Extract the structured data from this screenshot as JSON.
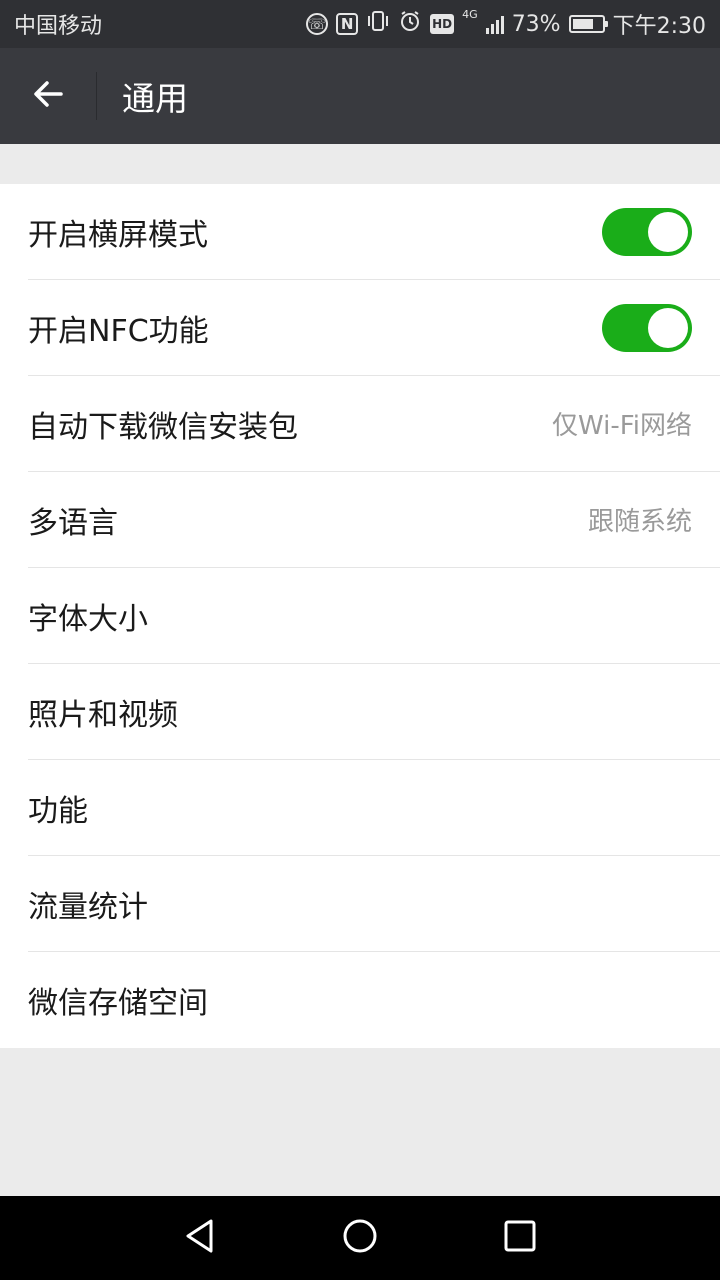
{
  "status_bar": {
    "carrier": "中国移动",
    "icons": [
      "hd-call-icon",
      "nfc-icon",
      "vibrate-icon",
      "alarm-icon",
      "hd-icon",
      "network-4g-icon",
      "signal-icon"
    ],
    "hd_label": "HD",
    "nfc_label": "N",
    "network_label": "4G",
    "battery_percent_text": "73%",
    "battery_level": 0.73,
    "time": "下午2:30"
  },
  "app_bar": {
    "title": "通用",
    "back_icon": "arrow-left-icon"
  },
  "settings": {
    "landscape": {
      "label": "开启横屏模式",
      "enabled": true
    },
    "nfc": {
      "label": "开启NFC功能",
      "enabled": true
    },
    "auto_download": {
      "label": "自动下载微信安装包",
      "value": "仅Wi-Fi网络"
    },
    "language": {
      "label": "多语言",
      "value": "跟随系统"
    },
    "font_size": {
      "label": "字体大小"
    },
    "photos_videos": {
      "label": "照片和视频"
    },
    "features": {
      "label": "功能"
    },
    "data_usage": {
      "label": "流量统计"
    },
    "storage": {
      "label": "微信存储空间"
    }
  },
  "colors": {
    "toggle_on": "#1aad19",
    "app_bar": "#393a3f",
    "status_bar": "#2f3034",
    "background": "#ebebeb"
  },
  "nav_bar": {
    "icons": [
      "back-triangle-icon",
      "home-circle-icon",
      "recents-square-icon"
    ]
  }
}
